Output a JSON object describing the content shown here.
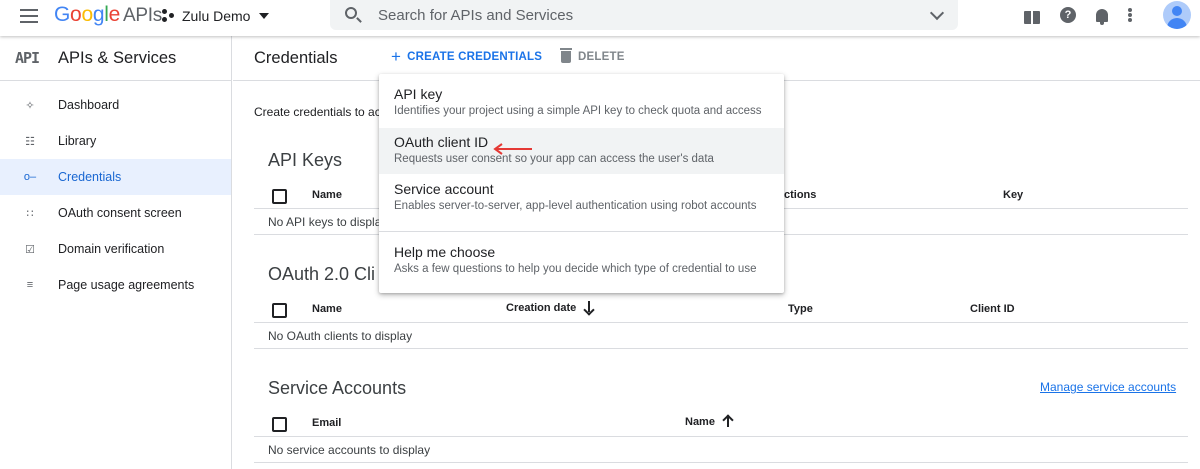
{
  "topbar": {
    "logo_google": "Google",
    "logo_apis": "APIs",
    "project_name": "Zulu Demo",
    "search_placeholder": "Search for APIs and Services",
    "help_glyph": "?"
  },
  "sidebar": {
    "api_mark": "API",
    "title": "APIs & Services",
    "items": [
      {
        "label": "Dashboard",
        "icon": "dashboard-icon"
      },
      {
        "label": "Library",
        "icon": "library-icon"
      },
      {
        "label": "Credentials",
        "icon": "key-icon",
        "active": true
      },
      {
        "label": "OAuth consent screen",
        "icon": "consent-icon"
      },
      {
        "label": "Domain verification",
        "icon": "checkbox-icon"
      },
      {
        "label": "Page usage agreements",
        "icon": "settings-list-icon"
      }
    ]
  },
  "header": {
    "title": "Credentials",
    "create_label": "CREATE CREDENTIALS",
    "delete_label": "DELETE"
  },
  "main": {
    "intro": "Create credentials to ac",
    "api_keys": {
      "title": "API Keys",
      "columns": [
        "Name",
        "ctions",
        "Key"
      ],
      "empty": "No API keys to displa"
    },
    "oauth": {
      "title": "OAuth 2.0 Cli",
      "columns": [
        "Name",
        "Creation date",
        "Type",
        "Client ID"
      ],
      "empty": "No OAuth clients to display"
    },
    "service_accounts": {
      "title": "Service Accounts",
      "manage_link": "Manage service accounts",
      "columns": [
        "Email",
        "Name"
      ],
      "empty": "No service accounts to display"
    }
  },
  "menu": {
    "items": [
      {
        "title": "API key",
        "desc": "Identifies your project using a simple API key to check quota and access"
      },
      {
        "title": "OAuth client ID",
        "desc": "Requests user consent so your app can access the user's data",
        "highlighted": true
      },
      {
        "title": "Service account",
        "desc": "Enables server-to-server, app-level authentication using robot accounts"
      },
      {
        "title": "Help me choose",
        "desc": "Asks a few questions to help you decide which type of credential to use"
      }
    ]
  },
  "colors": {
    "accent": "#1a73e8",
    "active_bg": "#e8f0fe",
    "annotation_arrow": "#e53935"
  }
}
